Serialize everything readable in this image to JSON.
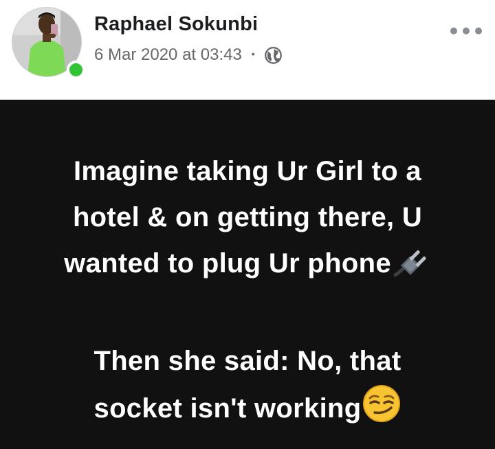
{
  "post": {
    "author": "Raphael Sokunbi",
    "timestamp": "6 Mar 2020 at 03:43",
    "separator": "·",
    "privacy_icon": "globe-icon",
    "more_icon": "more-options-icon",
    "online": true,
    "body": {
      "paragraph1": [
        "Imagine taking Ur Girl to a",
        "hotel & on getting there, U",
        "wanted to plug Ur phone"
      ],
      "paragraph1_emoji": "electric-plug-emoji",
      "paragraph2": [
        "Then she said: No, that",
        "socket isn't working"
      ],
      "paragraph2_emoji": "smirking-face-emoji"
    }
  },
  "colors": {
    "body_background": "#111111",
    "body_text": "#ffffff",
    "name_text": "#1c1e21",
    "meta_text": "#65676b",
    "online_dot": "#31c434"
  }
}
